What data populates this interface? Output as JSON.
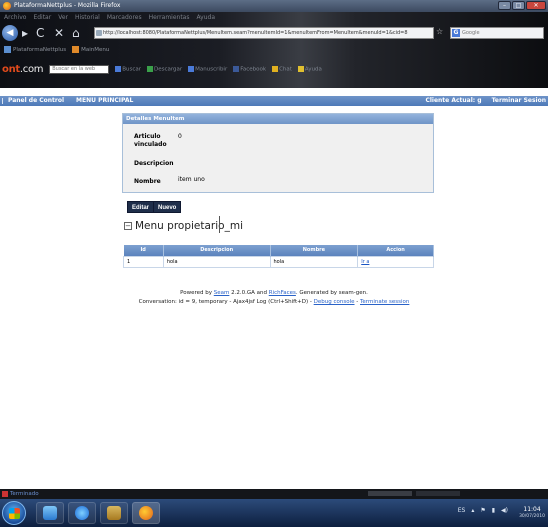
{
  "window": {
    "title": "PlataformaNettplus - Mozilla Firefox",
    "controls": [
      "–",
      "□",
      "✕"
    ]
  },
  "browser": {
    "menu": [
      "Archivo",
      "Editar",
      "Ver",
      "Historial",
      "Marcadores",
      "Herramientas",
      "Ayuda"
    ],
    "url": "http://localhost:8080/PlataformaNettplus/MenuItem.seam?menuItemId=1&menuItemFrom=MenuItem&menuId=1&cid=8",
    "search_engine_placeholder": "Google",
    "bookmarks": [
      {
        "label": "PlataformaNettplus",
        "icon": "page-icon"
      },
      {
        "label": "MainMenu",
        "icon": "folder-icon"
      }
    ],
    "toolbar": {
      "logo_main": "ont",
      "logo_suffix": ".com",
      "search_placeholder": "Buscar en la web",
      "items": [
        {
          "label": "Buscar",
          "icon": "search-icon",
          "color": "#4a7ad8"
        },
        {
          "label": "Descargar",
          "icon": "download-icon",
          "color": "#3aa04a"
        },
        {
          "label": "Manuscribir",
          "icon": "document-icon",
          "color": "#4a7ad8"
        },
        {
          "label": "Facebook",
          "icon": "facebook-icon",
          "color": "#3b5998"
        },
        {
          "label": "Chat",
          "icon": "chat-icon",
          "color": "#e0b020"
        },
        {
          "label": "Ayuda",
          "icon": "help-icon",
          "color": "#e0c030"
        }
      ]
    }
  },
  "app": {
    "nav_left": [
      "Panel de Control",
      "MENU PRINCIPAL"
    ],
    "client_label": "Cliente Actual: g",
    "logout_label": "Terminar Sesion",
    "panel_title": "Detalles MenuItem",
    "fields": [
      {
        "label": "Articulo vinculado",
        "value": "0"
      },
      {
        "label": "Descripcion",
        "value": ""
      },
      {
        "label": "Nombre",
        "value": "item uno"
      }
    ],
    "edit_label": "Editar",
    "new_label": "Nuevo",
    "section_title": "Menu propietario_mi",
    "section_toggle": "−",
    "table": {
      "headers": [
        "Id",
        "Descripcion",
        "Nombre",
        "Accion"
      ],
      "rows": [
        {
          "id": "1",
          "descripcion": "hola",
          "nombre": "hola",
          "accion": "Ir a"
        }
      ]
    },
    "footer": {
      "powered_prefix": "Powered by ",
      "seam_link": "Seam",
      "powered_mid": " 2.2.0.GA and ",
      "richfaces_link": "RichFaces",
      "powered_suffix": ". Generated by seam-gen.",
      "conversation_text": "Conversation: id = 9, temporary - Ajax4jsf Log (Ctrl+Shift+D) - ",
      "debug_link": "Debug console",
      "separator": " - ",
      "terminate_link": "Terminate session"
    }
  },
  "status": {
    "text": "Terminado"
  },
  "taskbar": {
    "language": "ES",
    "time": "11:04",
    "date": "30/07/2010"
  }
}
